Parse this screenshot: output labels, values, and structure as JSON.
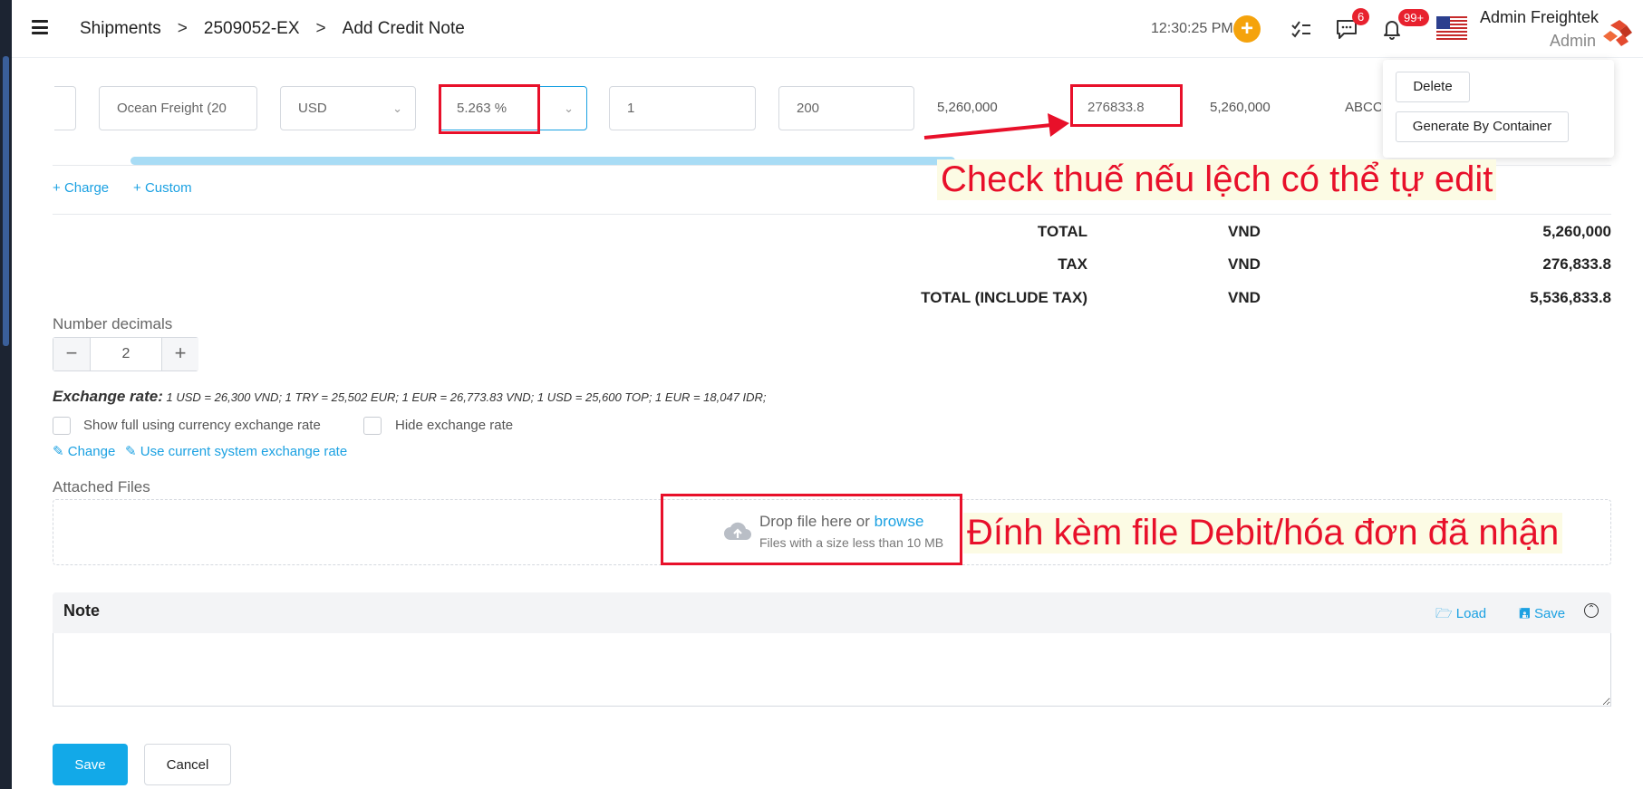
{
  "header": {
    "breadcrumbs": [
      "Shipments",
      "2509052-EX",
      "Add Credit Note"
    ],
    "separator": ">",
    "clock": "12:30:25 PM",
    "plus_label": "+",
    "messages_badge": "6",
    "notifications_badge": "99+",
    "user_name": "Admin Freightek",
    "user_role": "Admin"
  },
  "dropdown": {
    "delete_label": "Delete",
    "generate_label": "Generate By Container"
  },
  "charge_row": {
    "description": "Ocean Freight (20",
    "currency": "USD",
    "tax_rate": "5.263 %",
    "quantity": "1",
    "unit_price": "200",
    "amount": "5,260,000",
    "tax_amount": "276833.8",
    "total": "5,260,000",
    "partner": "ABCCO"
  },
  "actions": {
    "add_charge": "Charge",
    "add_custom": "Custom"
  },
  "annotations": {
    "tax_note": "Check thuế nếu lệch có thể tự edit",
    "file_note": "Đính kèm file Debit/hóa đơn đã nhận"
  },
  "totals": [
    {
      "label": "TOTAL",
      "currency": "VND",
      "value": "5,260,000"
    },
    {
      "label": "TAX",
      "currency": "VND",
      "value": "276,833.8"
    },
    {
      "label": "TOTAL (INCLUDE TAX)",
      "currency": "VND",
      "value": "5,536,833.8"
    }
  ],
  "decimals": {
    "label": "Number decimals",
    "value": "2",
    "minus": "−",
    "plus": "+"
  },
  "exchange": {
    "label": "Exchange rate:",
    "rates": "1 USD = 26,300 VND; 1 TRY = 25,502 EUR; 1 EUR = 26,773.83 VND; 1 USD = 25,600 TOP; 1 EUR = 18,047 IDR;",
    "show_full_label": "Show full using currency exchange rate",
    "hide_label": "Hide exchange rate",
    "change_link": "Change",
    "use_current_link": "Use current system exchange rate"
  },
  "attachments": {
    "label": "Attached Files",
    "drop_text": "Drop file here or",
    "browse": "browse",
    "size_hint": "Files with a size less than 10 MB"
  },
  "note": {
    "title": "Note",
    "load_label": "Load",
    "save_label": "Save",
    "value": ""
  },
  "footer": {
    "save_label": "Save",
    "cancel_label": "Cancel"
  },
  "colors": {
    "accent": "#1ba1e2",
    "annotation": "#e8102a",
    "badge": "#e8212e",
    "plus": "#f5a30c"
  }
}
